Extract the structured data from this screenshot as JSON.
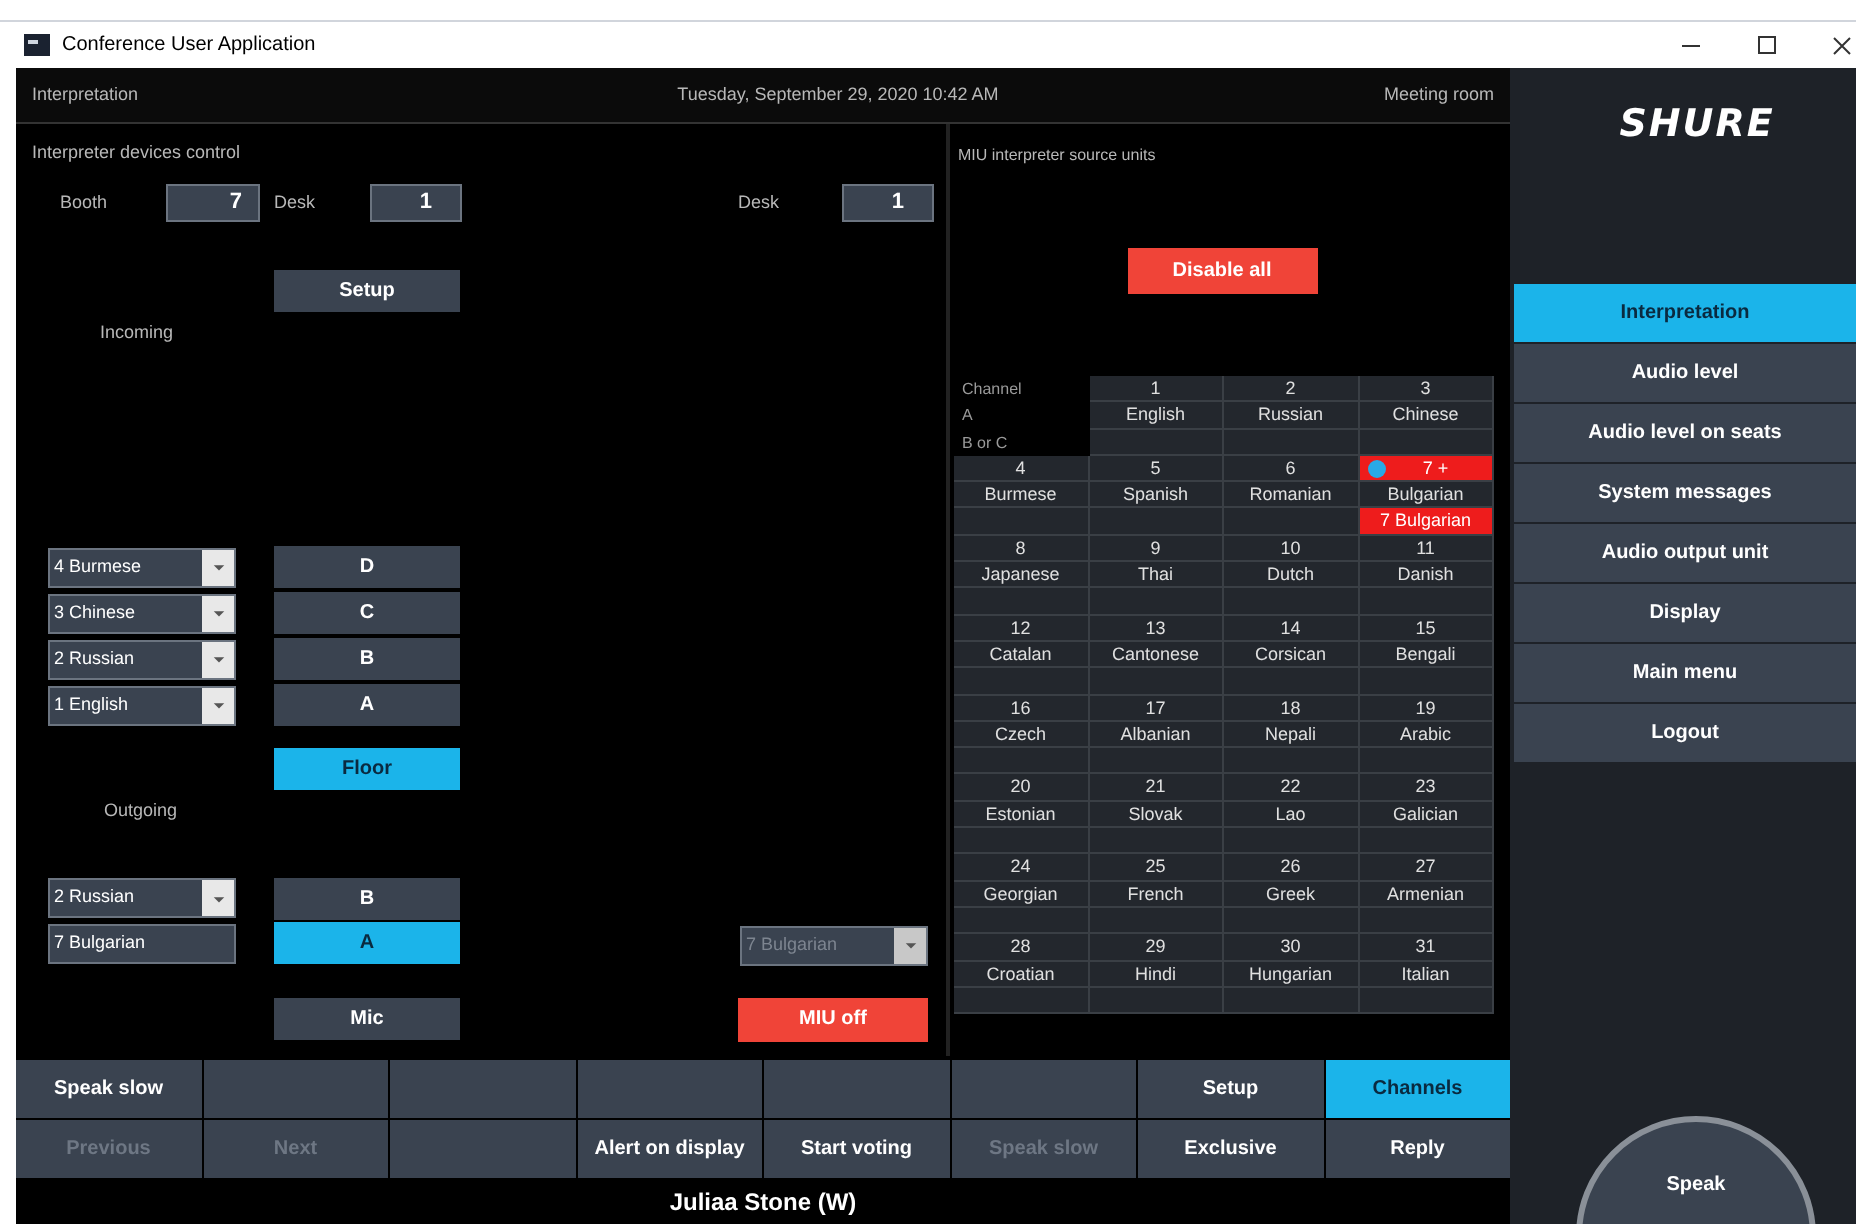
{
  "window": {
    "title": "Conference User Application"
  },
  "header": {
    "section": "Interpretation",
    "datetime": "Tuesday, September 29, 2020 10:42 AM",
    "room": "Meeting room"
  },
  "devices": {
    "title": "Interpreter devices control",
    "booth_label": "Booth",
    "booth": "7",
    "desk_label": "Desk",
    "desk": "1",
    "desk2_label": "Desk",
    "desk2": "1",
    "setup": "Setup",
    "incoming_label": "Incoming",
    "incoming": [
      {
        "language": "4 Burmese",
        "channel": "D",
        "selected": false
      },
      {
        "language": "3 Chinese",
        "channel": "C",
        "selected": false
      },
      {
        "language": "2 Russian",
        "channel": "B",
        "selected": false
      },
      {
        "language": "1 English",
        "channel": "A",
        "selected": false
      }
    ],
    "floor": {
      "label": "Floor",
      "selected": true
    },
    "outgoing_label": "Outgoing",
    "outgoing": [
      {
        "kind": "dropdown",
        "language": "2 Russian",
        "channel": "B",
        "selected": false
      },
      {
        "kind": "field",
        "language": "7 Bulgarian",
        "channel": "A",
        "selected": true
      }
    ],
    "miu_source": {
      "value": "7 Bulgarian",
      "disabled": true
    },
    "mic": "Mic",
    "miu_off": "MIU off"
  },
  "miu": {
    "title": "MIU interpreter source units",
    "disable_all": "Disable all",
    "header": [
      "Channel",
      "A",
      "B or C"
    ],
    "channels": [
      {
        "number": "1",
        "name": "English",
        "active": false
      },
      {
        "number": "2",
        "name": "Russian",
        "active": false
      },
      {
        "number": "3",
        "name": "Chinese",
        "active": false
      },
      {
        "number": "4",
        "name": "Burmese",
        "active": false
      },
      {
        "number": "5",
        "name": "Spanish",
        "active": false
      },
      {
        "number": "6",
        "name": "Romanian",
        "active": false
      },
      {
        "number": "7 +",
        "name": "Bulgarian",
        "b_or_c": "7 Bulgarian",
        "active": true
      },
      {
        "number": "8",
        "name": "Japanese",
        "active": false
      },
      {
        "number": "9",
        "name": "Thai",
        "active": false
      },
      {
        "number": "10",
        "name": "Dutch",
        "active": false
      },
      {
        "number": "11",
        "name": "Danish",
        "active": false
      },
      {
        "number": "12",
        "name": "Catalan",
        "active": false
      },
      {
        "number": "13",
        "name": "Cantonese",
        "active": false
      },
      {
        "number": "14",
        "name": "Corsican",
        "active": false
      },
      {
        "number": "15",
        "name": "Bengali",
        "active": false
      },
      {
        "number": "16",
        "name": "Czech",
        "active": false
      },
      {
        "number": "17",
        "name": "Albanian",
        "active": false
      },
      {
        "number": "18",
        "name": "Nepali",
        "active": false
      },
      {
        "number": "19",
        "name": "Arabic",
        "active": false
      },
      {
        "number": "20",
        "name": "Estonian",
        "active": false
      },
      {
        "number": "21",
        "name": "Slovak",
        "active": false
      },
      {
        "number": "22",
        "name": "Lao",
        "active": false
      },
      {
        "number": "23",
        "name": "Galician",
        "active": false
      },
      {
        "number": "24",
        "name": "Georgian",
        "active": false
      },
      {
        "number": "25",
        "name": "French",
        "active": false
      },
      {
        "number": "26",
        "name": "Greek",
        "active": false
      },
      {
        "number": "27",
        "name": "Armenian",
        "active": false
      },
      {
        "number": "28",
        "name": "Croatian",
        "active": false
      },
      {
        "number": "29",
        "name": "Hindi",
        "active": false
      },
      {
        "number": "30",
        "name": "Hungarian",
        "active": false
      },
      {
        "number": "31",
        "name": "Italian",
        "active": false
      }
    ]
  },
  "toolbar": [
    [
      {
        "kind": "button",
        "label": "Speak slow",
        "selected": false,
        "disabled": false
      },
      {
        "kind": "blank"
      },
      {
        "kind": "blank"
      },
      {
        "kind": "blank"
      },
      {
        "kind": "blank"
      },
      {
        "kind": "blank"
      },
      {
        "kind": "button",
        "label": "Setup",
        "selected": false,
        "disabled": false
      },
      {
        "kind": "button",
        "label": "Channels",
        "selected": true,
        "disabled": false
      }
    ],
    [
      {
        "kind": "button",
        "label": "Previous",
        "selected": false,
        "disabled": true
      },
      {
        "kind": "button",
        "label": "Next",
        "selected": false,
        "disabled": true
      },
      {
        "kind": "blank"
      },
      {
        "kind": "button",
        "label": "Alert on display",
        "selected": false,
        "disabled": false
      },
      {
        "kind": "button",
        "label": "Start voting",
        "selected": false,
        "disabled": false
      },
      {
        "kind": "button",
        "label": "Speak slow",
        "selected": false,
        "disabled": true
      },
      {
        "kind": "button",
        "label": "Exclusive",
        "selected": false,
        "disabled": false
      },
      {
        "kind": "button",
        "label": "Reply",
        "selected": false,
        "disabled": false
      }
    ]
  ],
  "speaker": "Juliaa Stone (W)",
  "sidebar": {
    "logo": "SHURE",
    "items": [
      {
        "label": "Interpretation",
        "selected": true
      },
      {
        "label": "Audio level",
        "selected": false
      },
      {
        "label": "Audio level on seats",
        "selected": false
      },
      {
        "label": "System messages",
        "selected": false
      },
      {
        "label": "Audio output unit",
        "selected": false
      },
      {
        "label": "Display",
        "selected": false
      },
      {
        "label": "Main menu",
        "selected": false
      },
      {
        "label": "Logout",
        "selected": false
      }
    ],
    "speak": "Speak"
  }
}
